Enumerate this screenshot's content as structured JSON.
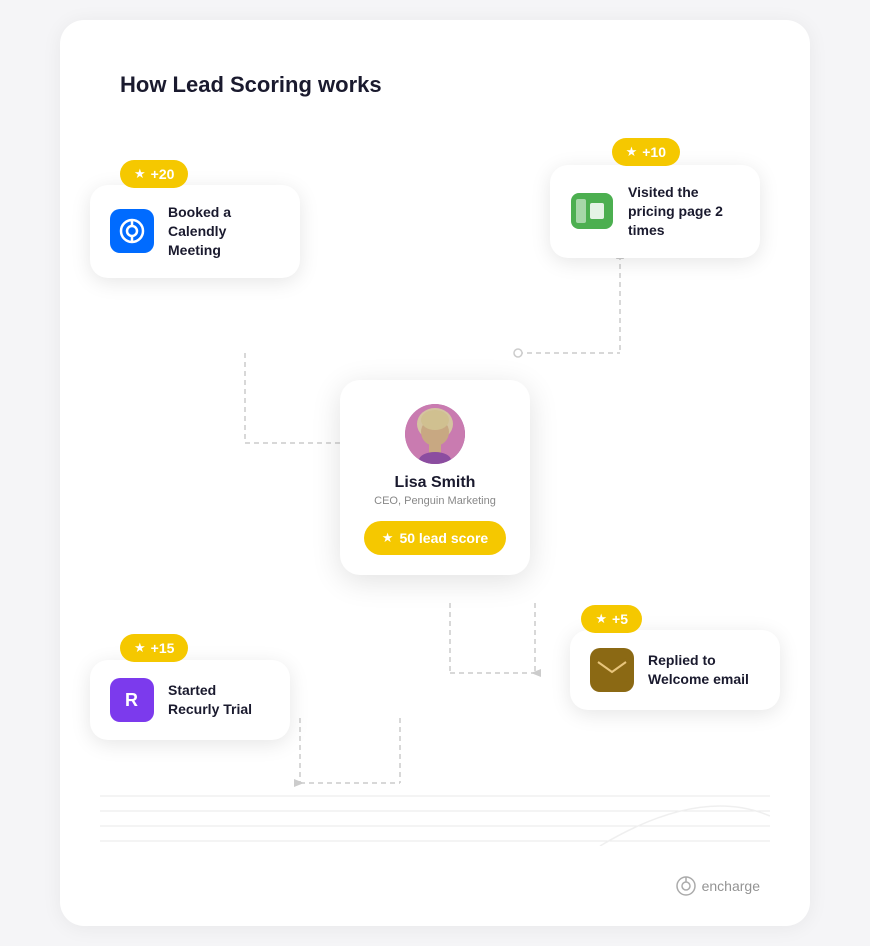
{
  "page": {
    "title": "How Lead Scoring works",
    "background": "#f5f5f7"
  },
  "badges": {
    "calendly": {
      "value": "+20",
      "label": "+20"
    },
    "pricing": {
      "value": "+10",
      "label": "+10"
    },
    "recurly": {
      "value": "+15",
      "label": "+15"
    },
    "email": {
      "value": "+5",
      "label": "+5"
    }
  },
  "cards": {
    "calendly": {
      "icon": "calendly-icon",
      "text": "Booked a Calendly Meeting"
    },
    "pricing": {
      "icon": "pricing-icon",
      "text": "Visited the pricing page 2 times"
    },
    "recurly": {
      "icon": "recurly-icon",
      "text": "Started Recurly Trial"
    },
    "email": {
      "icon": "email-icon",
      "text": "Replied to Welcome email"
    }
  },
  "contact": {
    "name": "Lisa Smith",
    "role": "CEO, Penguin Marketing",
    "lead_score_label": "50 lead score",
    "lead_score_number": "50"
  },
  "branding": {
    "company": "encharge"
  }
}
